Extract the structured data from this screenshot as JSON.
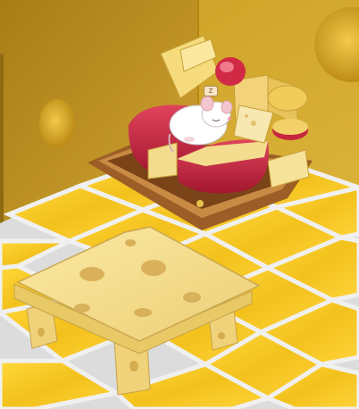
{
  "scene": {
    "bubble_text": "Z",
    "objects": [
      "cheese-wall-left",
      "cheese-wall-back",
      "cheese-tile-floor",
      "cheese-wheel-bed",
      "sleeping-mouse-pet",
      "swiss-cheese-table"
    ]
  },
  "colors": {
    "wall_left": "#c4991f",
    "wall_back": "#d2a92b",
    "floor_tile": "#f5c81e",
    "grout": "#e6e6e6",
    "wax_red": "#c8253f",
    "cheese_light": "#f3dc8e",
    "wood": "#b8783a",
    "table": "#f4de8e"
  }
}
